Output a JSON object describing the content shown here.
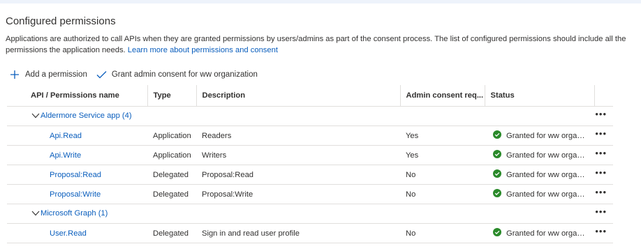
{
  "section": {
    "title": "Configured permissions",
    "description": "Applications are authorized to call APIs when they are granted permissions by users/admins as part of the consent process. The list of configured permissions should include all the permissions the application needs.",
    "learn_more_link": "Learn more about permissions and consent"
  },
  "toolbar": {
    "add_permission": "Add a permission",
    "grant_consent": "Grant admin consent for ww organization"
  },
  "table": {
    "headers": {
      "name": "API / Permissions name",
      "type": "Type",
      "description": "Description",
      "admin_consent": "Admin consent req...",
      "status": "Status"
    },
    "groups": [
      {
        "label": "Aldermore Service app (4)",
        "rows": [
          {
            "name": "Api.Read",
            "type": "Application",
            "description": "Readers",
            "admin_consent": "Yes",
            "status": "Granted for ww organiz..."
          },
          {
            "name": "Api.Write",
            "type": "Application",
            "description": "Writers",
            "admin_consent": "Yes",
            "status": "Granted for ww organiz..."
          },
          {
            "name": "Proposal:Read",
            "type": "Delegated",
            "description": "Proposal:Read",
            "admin_consent": "No",
            "status": "Granted for ww organiz..."
          },
          {
            "name": "Proposal:Write",
            "type": "Delegated",
            "description": "Proposal:Write",
            "admin_consent": "No",
            "status": "Granted for ww organiz..."
          }
        ]
      },
      {
        "label": "Microsoft Graph (1)",
        "rows": [
          {
            "name": "User.Read",
            "type": "Delegated",
            "description": "Sign in and read user profile",
            "admin_consent": "No",
            "status": "Granted for ww organiz..."
          }
        ]
      }
    ],
    "more_glyph": "•••"
  },
  "colors": {
    "link": "#0a5ebd",
    "success": "#2a8a2a",
    "border": "#e1dfdd"
  },
  "icons": {
    "add": "plus-icon",
    "consent": "checkmark-icon",
    "group_toggle": "chevron-down-icon",
    "status": "check-circle-icon",
    "row_menu": "more-icon"
  }
}
